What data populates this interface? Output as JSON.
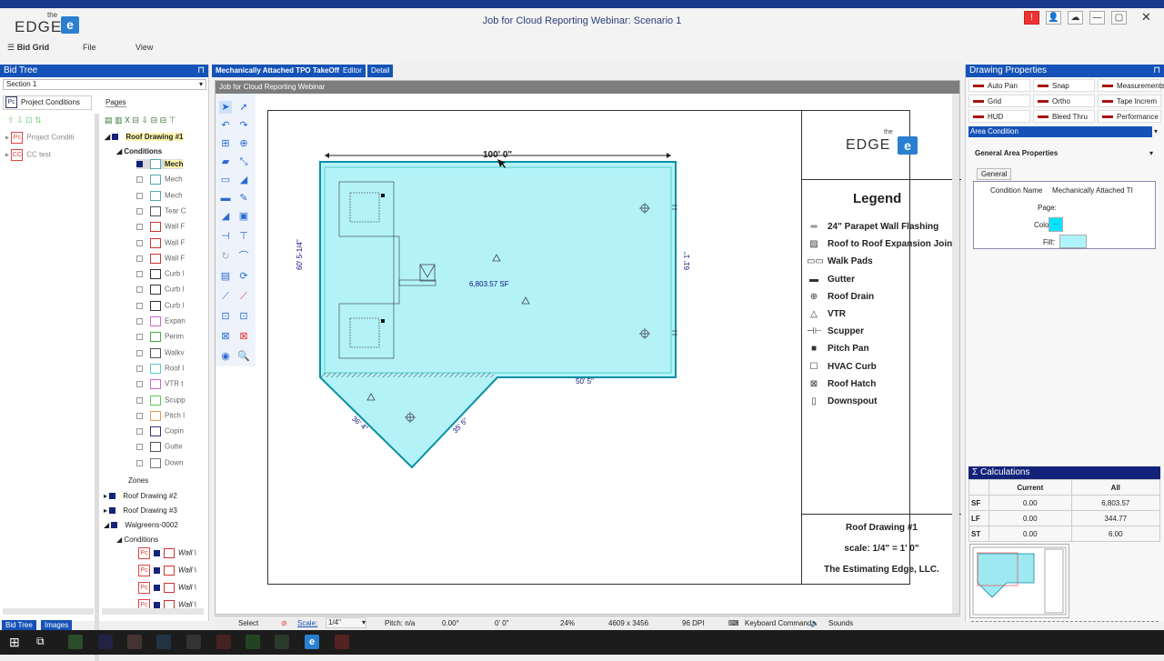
{
  "app": {
    "logo_the": "the",
    "logo_text": "EDGE",
    "logo_letter": "e",
    "window_title": "Job for Cloud Reporting Webinar: Scenario 1"
  },
  "menu": {
    "bid_grid": "Bid Grid",
    "file": "File",
    "view": "View"
  },
  "bid_tree": {
    "title": "Bid Tree",
    "section": "Section 1",
    "tab_project_conditions": "Project Conditions",
    "tab_pages": "Pages",
    "left_items": [
      "Project Conditi",
      "CC test"
    ],
    "roof1": "Roof Drawing #1",
    "conditions": "Conditions",
    "condition_items": [
      "Mech",
      "Mech",
      "Mech",
      "Tear C",
      "Wall F",
      "Wall F",
      "Wall F",
      "Curb I",
      "Curb I",
      "Curb I",
      "Expan",
      "Perim",
      "Walkv",
      "Roof I",
      "VTR t",
      "Scupp",
      "Pitch I",
      "Copin",
      "Gutte",
      "Down"
    ],
    "zones": "Zones",
    "roof2": "Roof Drawing #2",
    "roof3": "Roof Drawing #3",
    "walgreens": "Walgreens-0002",
    "conditions2": "Conditions",
    "wall_items": [
      "Wall \\",
      "Wall \\",
      "Wall \\",
      "Wall \\"
    ],
    "bottom_tab_bidtree": "Bid Tree",
    "bottom_tab_images": "Images"
  },
  "center": {
    "tab_takeoff": "Mechanically Attached TPO TakeOff",
    "tab_editor": "Editor",
    "tab_detail": "Detail",
    "canvas_title": "Job for Cloud Reporting Webinar"
  },
  "drawing": {
    "dim_top": "100' 0\"",
    "dim_left": "60' 5-1/4\"",
    "dim_right": "61' 1\"",
    "dim_bottom": "50' 5\"",
    "dim_diag_left": "36' 4\"",
    "dim_diag_right": "35' 5\"",
    "area": "6,803.57 SF",
    "legend_title": "Legend",
    "legend_items": [
      {
        "sym": "═",
        "label": "24\" Parapet Wall Flashing"
      },
      {
        "sym": "▨",
        "label": "Roof to Roof Expansion Joint"
      },
      {
        "sym": "▭▭",
        "label": "Walk Pads"
      },
      {
        "sym": "▬",
        "label": "Gutter"
      },
      {
        "sym": "⊕",
        "label": "Roof Drain"
      },
      {
        "sym": "△",
        "label": "VTR"
      },
      {
        "sym": "⊣⊢",
        "label": "Scupper"
      },
      {
        "sym": "■",
        "label": "Pitch Pan"
      },
      {
        "sym": "☐",
        "label": "HVAC Curb"
      },
      {
        "sym": "⊠",
        "label": "Roof Hatch"
      },
      {
        "sym": "▯",
        "label": "Downspout"
      }
    ],
    "sheet_name": "Roof Drawing #1",
    "scale_text": "scale: 1/4\" = 1' 0\"",
    "company": "The Estimating Edge, LLC."
  },
  "status": {
    "select": "Select",
    "scale_label": "Scale:",
    "scale_value": "1/4\"",
    "pitch": "Pitch: n/a",
    "angle": "0.00°",
    "length": "0' 0\"",
    "zoom": "24%",
    "size": "4609 x 3456",
    "dpi": "96 DPI",
    "keyboard": "Keyboard Command",
    "sounds": "Sounds"
  },
  "properties": {
    "title": "Drawing Properties",
    "buttons": [
      "Auto Pan",
      "Snap",
      "Measurements",
      "Grid",
      "Ortho",
      "Tape Increm",
      "HUD",
      "Bleed Thru",
      "Performance"
    ],
    "area_condition": "Area Condition",
    "general_area": "General Area Properties",
    "general_tab": "General",
    "cond_name_label": "Condition Name",
    "cond_name_value": "Mechanically Attached TI",
    "page_label": "Page:",
    "color_label": "Color:",
    "fill_label": "Fill:",
    "ellipsis": "...",
    "color_fill": "#00e5ff",
    "fill_fill": "#aef3fb"
  },
  "calc": {
    "title": "Calculations",
    "col_current": "Current",
    "col_all": "All",
    "rows": [
      {
        "k": "SF",
        "c": "0.00",
        "a": "6,803.57"
      },
      {
        "k": "LF",
        "c": "0.00",
        "a": "344.77"
      },
      {
        "k": "ST",
        "c": "0.00",
        "a": "6.00"
      }
    ]
  }
}
